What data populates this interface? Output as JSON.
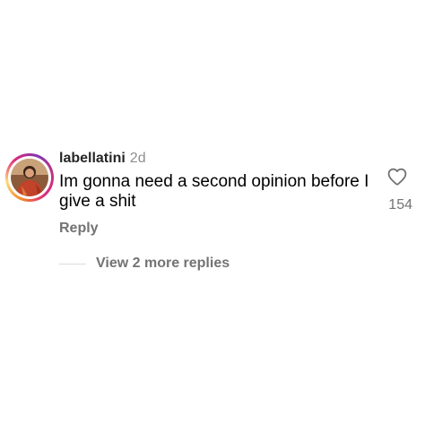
{
  "comment": {
    "username": "labellatini",
    "time_ago": "2d",
    "text": "Im gonna need a second opinion before I give a shit",
    "like_count": "154",
    "heart_icon": "heart-outline-icon",
    "reply_label": "Reply",
    "view_replies_label": "View 2 more replies"
  },
  "colors": {
    "primary_text": "#000000",
    "secondary_text": "#737373",
    "story_ring_start": "#f58529",
    "story_ring_end": "#dd2a7b"
  }
}
